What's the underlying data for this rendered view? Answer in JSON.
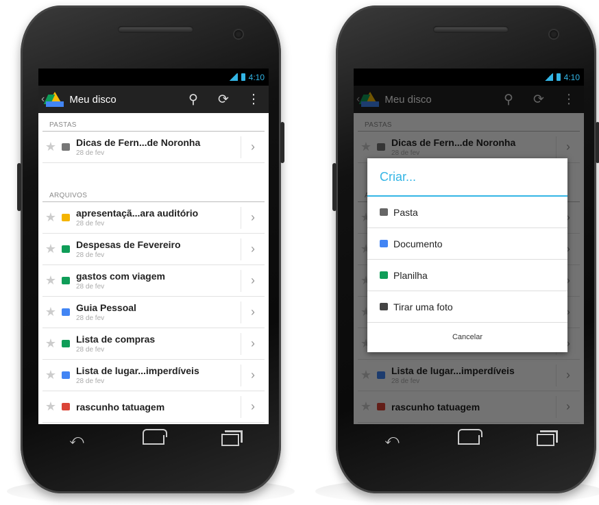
{
  "colors": {
    "accent": "#33b5e5",
    "folder": "#777777",
    "slides": "#f4b400",
    "sheets": "#0f9d58",
    "docs": "#4285f4",
    "drawing": "#db4437"
  },
  "status": {
    "time": "4:10"
  },
  "actionbar": {
    "title": "Meu disco",
    "search_icon": "search-icon",
    "refresh_icon": "refresh-icon",
    "overflow_icon": "overflow-menu-icon"
  },
  "sections": {
    "folders": "PASTAS",
    "files": "ARQUIVOS"
  },
  "folders": [
    {
      "name": "Dicas de Fern...de Noronha",
      "date": "28 de fev",
      "icon": "folder-icon",
      "color": "#777777"
    }
  ],
  "files": [
    {
      "name": "apresentaçã...ara auditório",
      "date": "28 de fev",
      "icon": "presentation-icon",
      "color": "#f4b400"
    },
    {
      "name": "Despesas de Fevereiro",
      "date": "28 de fev",
      "icon": "spreadsheet-icon",
      "color": "#0f9d58"
    },
    {
      "name": "gastos com viagem",
      "date": "28 de fev",
      "icon": "spreadsheet-icon",
      "color": "#0f9d58"
    },
    {
      "name": "Guia Pessoal",
      "date": "28 de fev",
      "icon": "document-icon",
      "color": "#4285f4"
    },
    {
      "name": "Lista de compras",
      "date": "28 de fev",
      "icon": "spreadsheet-icon",
      "color": "#0f9d58"
    },
    {
      "name": "Lista de lugar...imperdíveis",
      "date": "28 de fev",
      "icon": "document-icon",
      "color": "#4285f4"
    },
    {
      "name": "rascunho tatuagem",
      "date": "",
      "icon": "drawing-icon",
      "color": "#db4437"
    }
  ],
  "dialog": {
    "title": "Criar...",
    "items": [
      {
        "label": "Pasta",
        "icon": "folder-icon",
        "color": "#666666"
      },
      {
        "label": "Documento",
        "icon": "document-icon",
        "color": "#4285f4"
      },
      {
        "label": "Planilha",
        "icon": "spreadsheet-icon",
        "color": "#0f9d58"
      },
      {
        "label": "Tirar uma foto",
        "icon": "camera-icon",
        "color": "#444444"
      }
    ],
    "cancel": "Cancelar"
  },
  "navbar": {
    "back": "back-icon",
    "home": "home-icon",
    "recent": "recent-apps-icon"
  }
}
